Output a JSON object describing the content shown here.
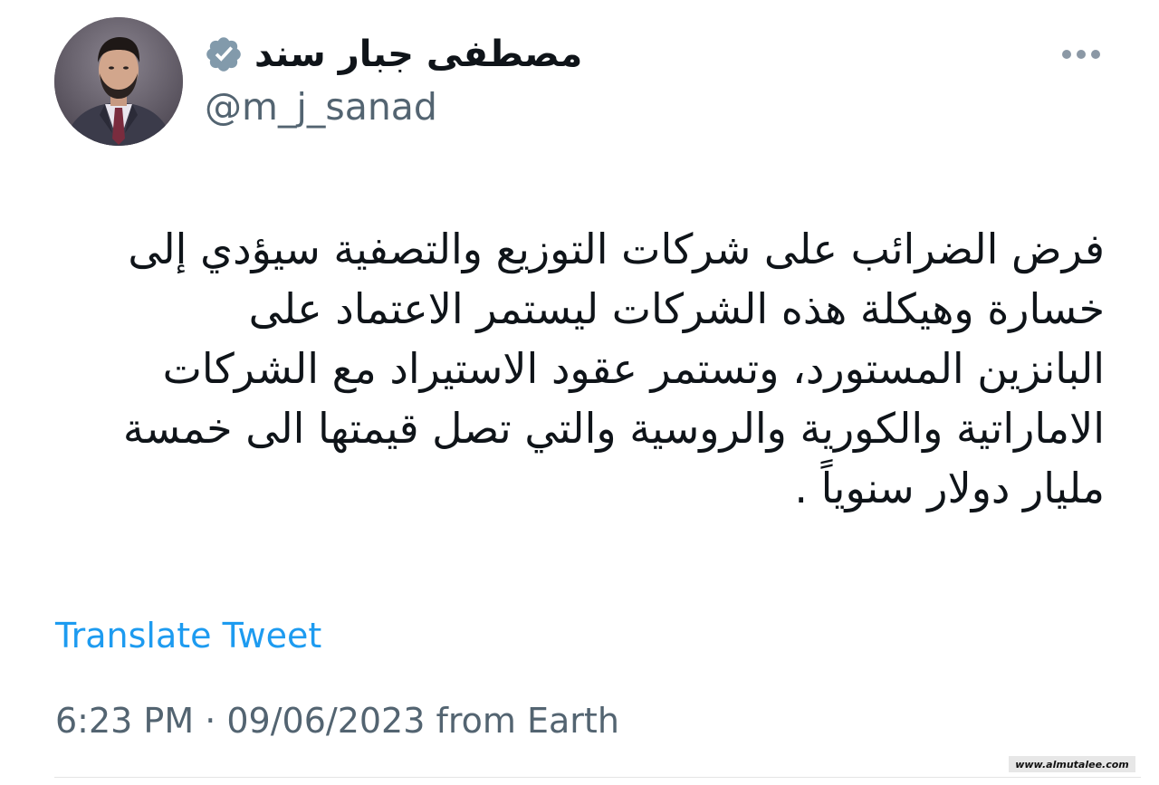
{
  "author": {
    "display_name": "مصطفى جبار سند",
    "handle": "@m_j_sanad",
    "verified": true,
    "avatar_icon": "profile-photo"
  },
  "more_icon": "more-horizontal-icon",
  "tweet": {
    "lines": [
      "فرض الضرائب على شركات التوزيع والتصفية سيؤدي إلى",
      "خسارة وهيكلة هذه الشركات ليستمر الاعتماد على",
      "البانزين المستورد، وتستمر عقود الاستيراد مع الشركات",
      "الاماراتية والكورية والروسية والتي تصل قيمتها الى خمسة",
      "مليار دولار سنوياً ."
    ]
  },
  "translate_label": "Translate Tweet",
  "meta": {
    "time": "6:23 PM",
    "separator": " · ",
    "date": "09/06/2023",
    "source": " from Earth"
  },
  "watermark": "www.almutalee.com",
  "colors": {
    "text_primary": "#0f1419",
    "text_secondary": "#536471",
    "link": "#1d9bf0",
    "verified_badge": "#829aab",
    "more_dots": "#8b98a5"
  }
}
